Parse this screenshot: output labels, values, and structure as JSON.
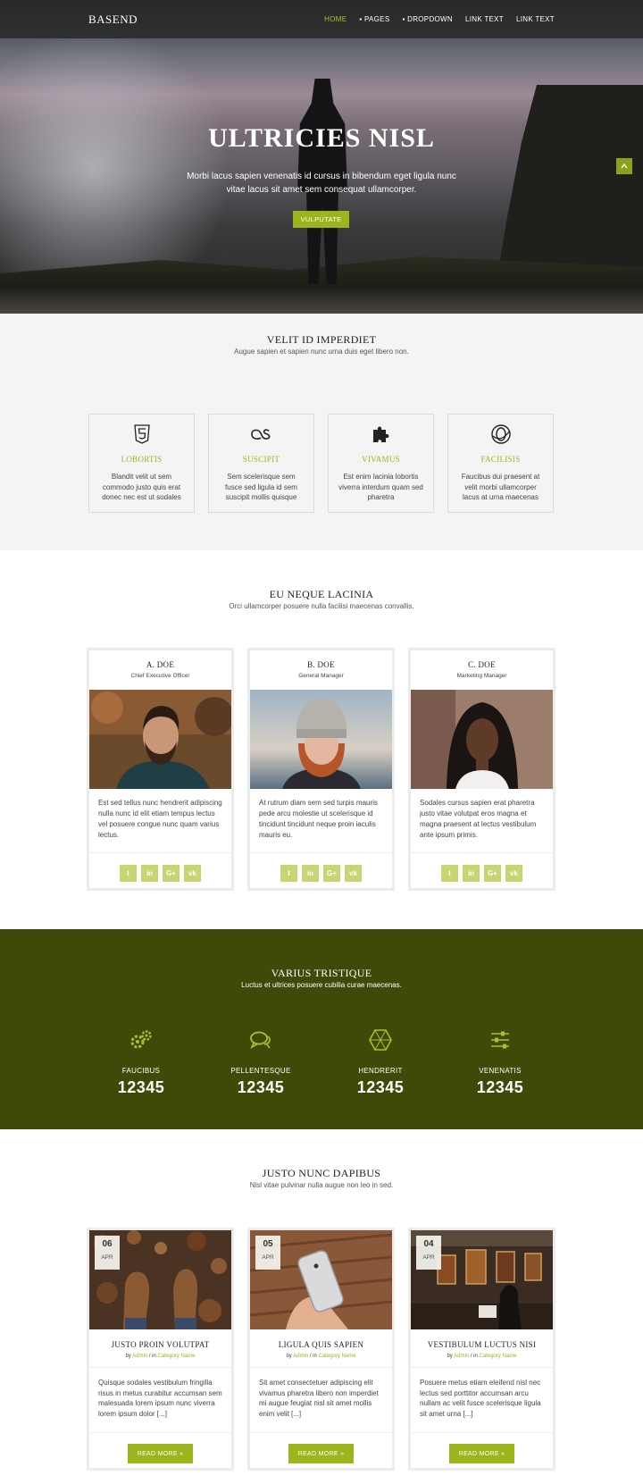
{
  "header": {
    "logo": "BASEND",
    "nav": [
      "HOME",
      "▪ PAGES",
      "▪ DROPDOWN",
      "LINK TEXT",
      "LINK TEXT"
    ]
  },
  "hero": {
    "title": "ULTRICIES NISL",
    "subtitle": "Morbi lacus sapien venenatis id cursus in bibendum eget ligula nunc vitae lacus sit amet sem consequat ullamcorper.",
    "button": "VULPUTATE"
  },
  "features": {
    "title": "VELIT ID IMPERDIET",
    "subtitle": "Augue sapien et sapien nunc urna duis eget libero non.",
    "items": [
      {
        "icon": "html5-icon",
        "title": "LOBORTIS",
        "text": "Blandit velit ut sem commodo justo quis erat donec nec est ut sodales"
      },
      {
        "icon": "lastfm-icon",
        "title": "SUSCIPIT",
        "text": "Sem scelerisque sem fusce sed ligula id sem suscipit mollis quisque"
      },
      {
        "icon": "puzzle-icon",
        "title": "VIVAMUS",
        "text": "Est enim lacinia lobortis viverra interdum quam sed pharetra"
      },
      {
        "icon": "opera-icon",
        "title": "FACILISIS",
        "text": "Faucibus dui praesent at velit morbi ullamcorper lacus at urna maecenas"
      }
    ]
  },
  "team": {
    "title": "EU NEQUE LACINIA",
    "subtitle": "Orci ullamcorper posuere nulla facilisi maecenas convallis.",
    "members": [
      {
        "name": "A. DOE",
        "role": "Chief Executive Officer",
        "text": "Est sed tellus nunc hendrerit adipiscing nulla nunc id elit etiam tempus lectus vel posuere congue nunc quam varius lectus."
      },
      {
        "name": "B. DOE",
        "role": "General Manager",
        "text": "At rutrum diam sem sed turpis mauris pede arcu molestie ut scelerisque id tincidunt tincidunt neque proin iaculis mauris eu."
      },
      {
        "name": "C. DOE",
        "role": "Marketing Manager",
        "text": "Sodales cursus sapien erat pharetra justo vitae volutpat eros magna et magna praesent at lectus vestibulum ante ipsum primis."
      }
    ],
    "social": [
      "t",
      "in",
      "G+",
      "vk"
    ]
  },
  "stats": {
    "title": "VARIUS TRISTIQUE",
    "subtitle": "Luctus et ultrices posuere cubilia curae maecenas.",
    "items": [
      {
        "icon": "gears-icon",
        "label": "FAUCIBUS",
        "value": "12345"
      },
      {
        "icon": "comments-icon",
        "label": "PELLENTESQUE",
        "value": "12345"
      },
      {
        "icon": "hexagon-icon",
        "label": "HENDRERIT",
        "value": "12345"
      },
      {
        "icon": "sliders-icon",
        "label": "VENENATIS",
        "value": "12345"
      }
    ]
  },
  "blog": {
    "title": "JUSTO NUNC DAPIBUS",
    "subtitle": "Nisl vitae pulvinar nulla augue non leo in sed.",
    "posts": [
      {
        "day": "06",
        "month": "APR",
        "title": "JUSTO PROIN VOLUTPAT",
        "by": "by",
        "author": "Admin",
        "in": "/ in",
        "category": "Category Name",
        "text": "Quisque sodales vestibulum fringilla risus in metus curabitur accumsan sem malesuada lorem ipsum nunc viverra lorem ipsum dolor [...]",
        "button": "READ MORE »"
      },
      {
        "day": "05",
        "month": "APR",
        "title": "LIGULA QUIS SAPIEN",
        "by": "by",
        "author": "Admin",
        "in": "/ in",
        "category": "Category Name",
        "text": "Sit amet consectetuer adipiscing elit vivamus pharetra libero non imperdiet mi augue feugiat nisl sit amet mollis enim velit [...]",
        "button": "READ MORE »"
      },
      {
        "day": "04",
        "month": "APR",
        "title": "VESTIBULUM LUCTUS NISI",
        "by": "by",
        "author": "Admin",
        "in": "/ in",
        "category": "Category Name",
        "text": "Posuere metus etiam eleifend nisl nec lectus sed porttitor accumsan arcu nullam ac velit fusce scelerisque ligula sit amet urna [...]",
        "button": "READ MORE »"
      }
    ]
  },
  "colors": {
    "accent": "#9bb51d",
    "stats_bg": "#404a08",
    "features_bg": "#f4f4f4"
  }
}
